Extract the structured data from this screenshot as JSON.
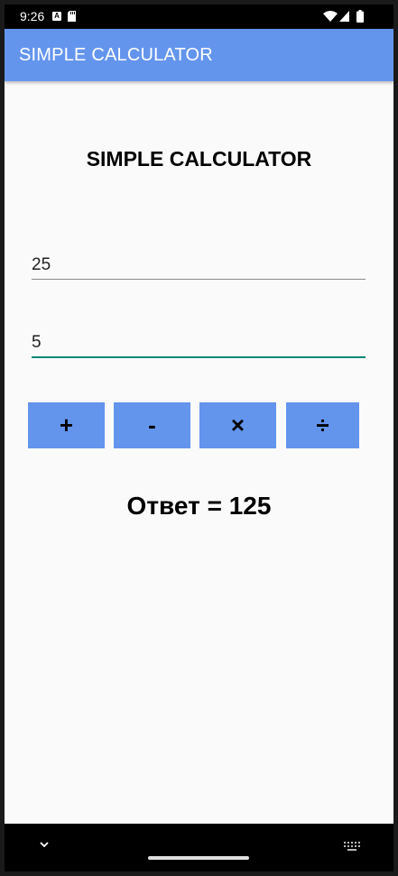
{
  "status_bar": {
    "time": "9:26",
    "notification_a": "A",
    "icons": [
      "a-notification-icon",
      "sd-card-icon",
      "wifi-icon",
      "signal-icon",
      "battery-icon"
    ]
  },
  "app_bar": {
    "title": "SIMPLE CALCULATOR",
    "color": "#6495ed"
  },
  "main": {
    "heading": "SIMPLE CALCULATOR",
    "first_number": "25",
    "second_number": "5",
    "buttons": {
      "plus": "+",
      "minus": "-",
      "times": "×",
      "divide": "÷"
    },
    "answer": "Ответ = 125"
  },
  "nav_bar": {
    "icons": [
      "back-chevron-icon",
      "home-pill",
      "keyboard-icon"
    ]
  },
  "colors": {
    "accent": "#6495ed",
    "focused_underline": "#008577",
    "background": "#fafafa"
  }
}
